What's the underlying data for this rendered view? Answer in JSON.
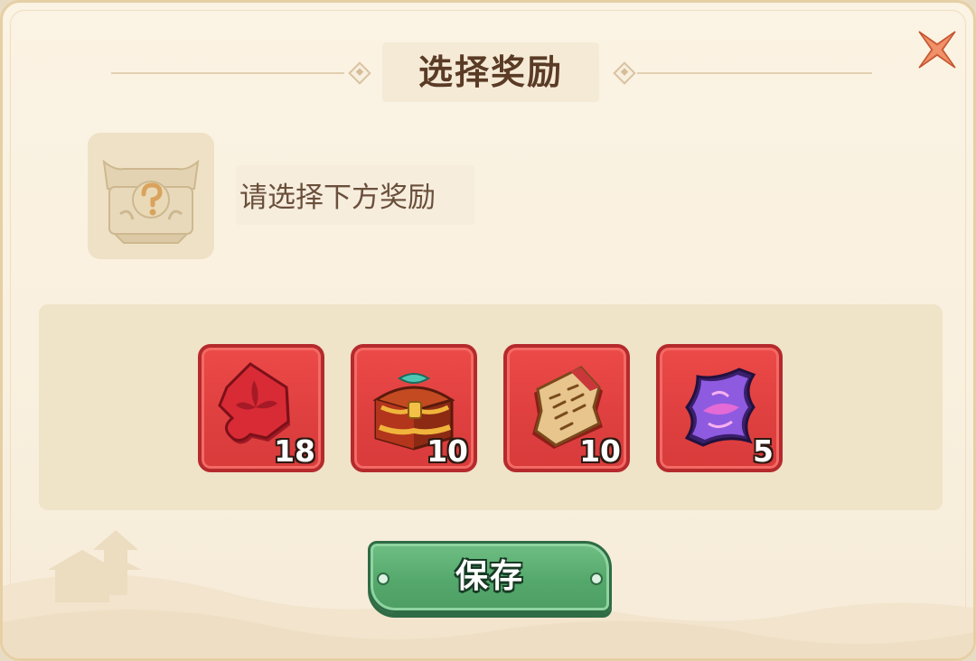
{
  "dialog": {
    "title": "选择奖励",
    "prompt": "请选择下方奖励",
    "close_icon": "close-x-icon",
    "chest_icon": "mystery-chest-icon"
  },
  "rewards": [
    {
      "icon": "red-puzzle-emblem-icon",
      "quantity": "18"
    },
    {
      "icon": "treasure-chest-icon",
      "quantity": "10"
    },
    {
      "icon": "ancient-scroll-icon",
      "quantity": "10"
    },
    {
      "icon": "purple-ticket-icon",
      "quantity": "5"
    }
  ],
  "actions": {
    "save_label": "保存"
  },
  "colors": {
    "panel_bg": "#f9f0df",
    "title_text": "#5a3b26",
    "slot_red": "#de3f3f",
    "button_green": "#55a86c",
    "close_orange": "#e4794e"
  }
}
